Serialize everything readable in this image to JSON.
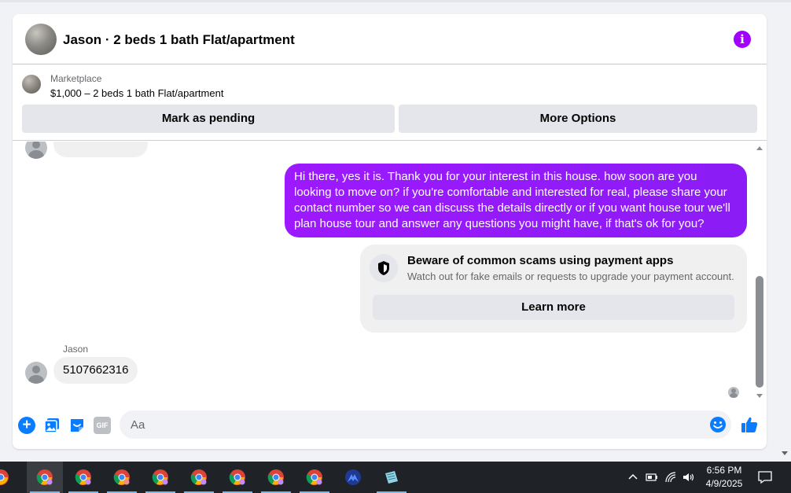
{
  "header": {
    "title": "Jason · 2 beds 1 bath Flat/apartment"
  },
  "listing": {
    "source_label": "Marketplace",
    "price_title": "$1,000 – 2 beds 1 bath Flat/apartment",
    "mark_pending_label": "Mark as pending",
    "more_options_label": "More Options"
  },
  "thread": {
    "outgoing_message": "Hi there, yes it is. Thank you for your interest in this house. how soon are you looking to move on? if you're comfortable and interested for real, please share your contact number so we can discuss the details directly or if you want house tour we'll plan house tour and answer any questions you might have, if that's ok for you?",
    "scam_warning": {
      "title": "Beware of common scams using payment apps",
      "body": "Watch out for fake emails or requests to upgrade your payment account.",
      "button_label": "Learn more"
    },
    "incoming_sender": "Jason",
    "incoming_message": "5107662316"
  },
  "composer": {
    "placeholder": "Aa",
    "icons": [
      "plus-icon",
      "photo-icon",
      "sticker-icon",
      "gif-icon",
      "emoji-icon",
      "like-icon"
    ],
    "gif_label": "GIF"
  },
  "taskbar": {
    "time": "6:56 PM",
    "date": "4/9/2025"
  },
  "colors": {
    "accent": "#a100ff",
    "outgoing_bubble": "#9d19ff",
    "messenger_blue": "#0a7cff"
  }
}
